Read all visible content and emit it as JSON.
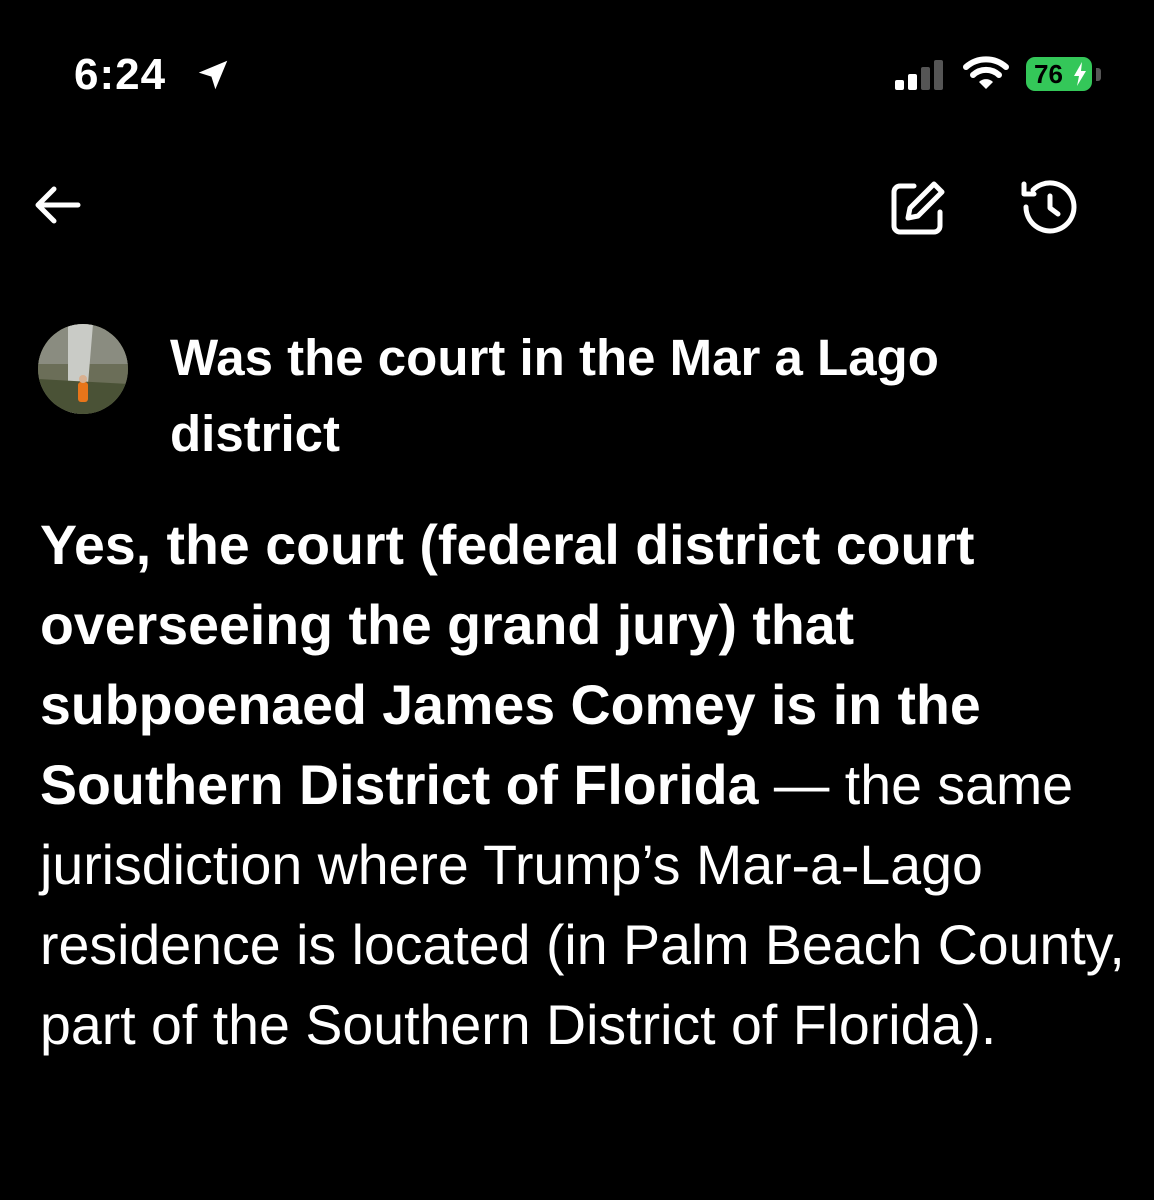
{
  "status_bar": {
    "time": "6:24",
    "battery_level": "76",
    "battery_color": "#34c759",
    "icons": [
      "location-arrow-icon",
      "cellular-signal-icon",
      "wifi-icon",
      "battery-icon",
      "charging-bolt-icon"
    ]
  },
  "nav": {
    "back_icon": "arrow-left-icon",
    "edit_icon": "pencil-square-icon",
    "history_icon": "history-clock-icon"
  },
  "conversation": {
    "question": "Was the court in the Mar a Lago district",
    "answer_bold": "Yes, the court (federal district court overseeing the grand jury) that subpoenaed James Comey is in the Southern District of Florida",
    "answer_rest": " — the same jurisdiction where Trump’s Mar-a-Lago residence is located (in Palm Beach County, part of the Southern District of Florida)."
  }
}
